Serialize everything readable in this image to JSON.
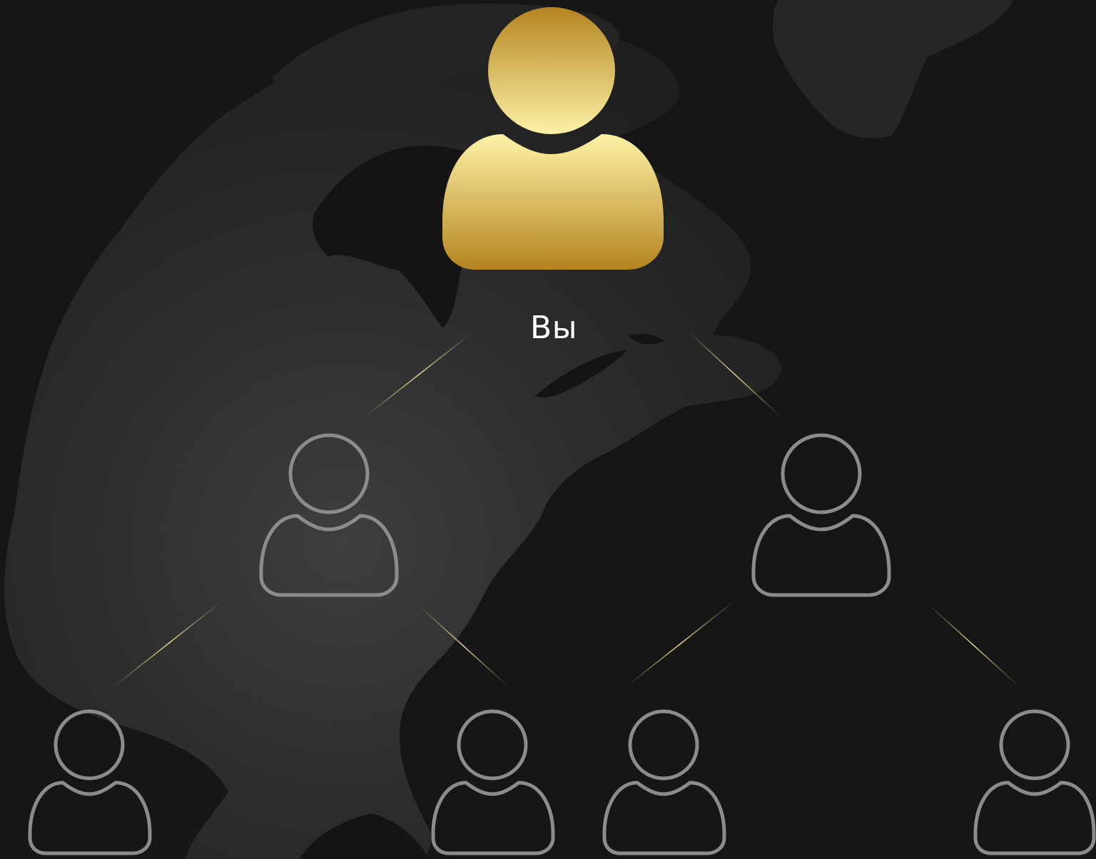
{
  "root": {
    "label": "Вы"
  },
  "tree": {
    "levels": [
      1,
      2,
      4
    ],
    "connections": [
      {
        "from": "root",
        "to": "child-1"
      },
      {
        "from": "root",
        "to": "child-2"
      },
      {
        "from": "child-1",
        "to": "grandchild-1"
      },
      {
        "from": "child-1",
        "to": "grandchild-2"
      },
      {
        "from": "child-2",
        "to": "grandchild-3"
      },
      {
        "from": "child-2",
        "to": "grandchild-4"
      }
    ]
  },
  "icons": {
    "root": "person-icon-filled-gold",
    "descendant": "person-icon-outline"
  },
  "colors": {
    "background": "#161616",
    "gold_light": "#fdf2a6",
    "gold_dark": "#b48420",
    "outline": "#8c8c8c",
    "connector": "#cbb773",
    "map_land": "#2a2a2a"
  }
}
